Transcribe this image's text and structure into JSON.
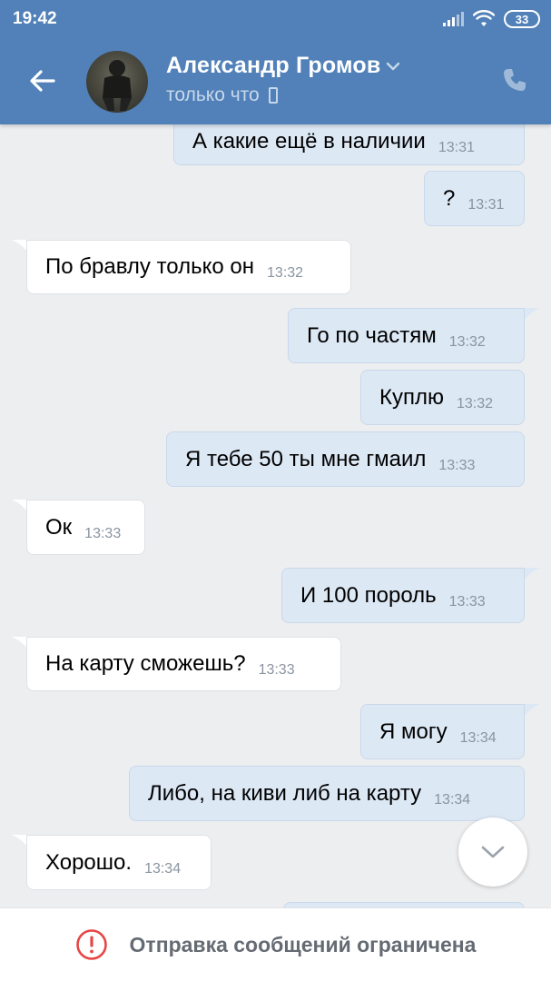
{
  "status_bar": {
    "time": "19:42",
    "battery": "33"
  },
  "header": {
    "contact_name": "Александр Громов",
    "contact_status": "только что"
  },
  "messages": [
    {
      "direction": "out",
      "text": "А какие ещё в наличии",
      "time": "13:31"
    },
    {
      "direction": "out",
      "text": "?",
      "time": "13:31"
    },
    {
      "direction": "in",
      "text": "По бравлу только он",
      "time": "13:32"
    },
    {
      "direction": "out",
      "text": "Го по частям",
      "time": "13:32"
    },
    {
      "direction": "out",
      "text": "Куплю",
      "time": "13:32"
    },
    {
      "direction": "out",
      "text": "Я тебе 50 ты мне гмаил",
      "time": "13:33"
    },
    {
      "direction": "in",
      "text": "Ок",
      "time": "13:33"
    },
    {
      "direction": "out",
      "text": "И 100 пороль",
      "time": "13:33"
    },
    {
      "direction": "in",
      "text": "На карту сможешь?",
      "time": "13:33"
    },
    {
      "direction": "out",
      "text": "Я могу",
      "time": "13:34"
    },
    {
      "direction": "out",
      "text": "Либо, на киви либ на карту",
      "time": "13:34"
    },
    {
      "direction": "in",
      "text": "Хорошо.",
      "time": "13:34"
    }
  ],
  "footer": {
    "restriction_text": "Отправка сообщений ограничена"
  },
  "colors": {
    "header": "#5181b8",
    "background": "#edeef0",
    "outgoing_bubble": "#dde8f5",
    "incoming_bubble": "#ffffff",
    "warning": "#e64646"
  },
  "icons": {
    "back": "back-arrow-icon",
    "call": "phone-icon",
    "scroll_down": "chevron-down-icon",
    "warning": "warning-icon"
  }
}
